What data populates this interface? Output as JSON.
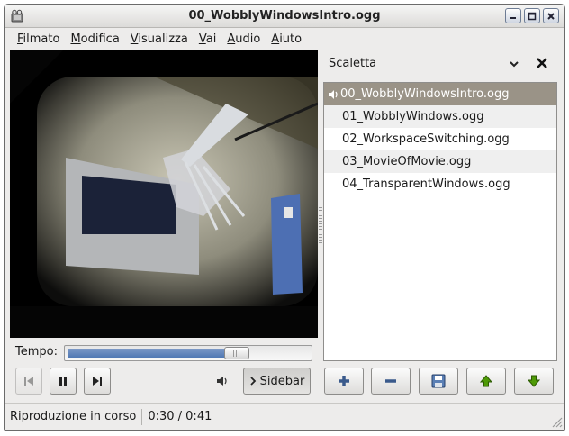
{
  "window": {
    "title": "00_WobblyWindowsIntro.ogg",
    "controls": [
      "minimize-icon",
      "maximize-icon",
      "close-icon"
    ]
  },
  "menubar": {
    "items": [
      {
        "u": "F",
        "rest": "ilmato"
      },
      {
        "u": "M",
        "rest": "odifica"
      },
      {
        "u": "V",
        "rest": "isualizza"
      },
      {
        "u": "V",
        "rest": "ai"
      },
      {
        "u": "A",
        "rest": "udio"
      },
      {
        "u": "A",
        "rest": "iuto"
      }
    ]
  },
  "player": {
    "time_label": "Tempo:",
    "position_fraction": 0.7,
    "buttons": {
      "previous": {
        "icon": "skip-previous-icon",
        "enabled": false
      },
      "pause": {
        "icon": "pause-icon",
        "enabled": true
      },
      "next": {
        "icon": "skip-next-icon",
        "enabled": true
      },
      "volume": {
        "icon": "speaker-icon"
      },
      "sidebar": {
        "icon": "chevron-right-icon",
        "u": "S",
        "rest": "idebar"
      }
    }
  },
  "sidebar": {
    "title": "Scaletta",
    "playlist": [
      {
        "name": "00_WobblyWindowsIntro.ogg",
        "playing": true
      },
      {
        "name": "01_WobblyWindows.ogg",
        "playing": false
      },
      {
        "name": "02_WorkspaceSwitching.ogg",
        "playing": false
      },
      {
        "name": "03_MovieOfMovie.ogg",
        "playing": false
      },
      {
        "name": "04_TransparentWindows.ogg",
        "playing": false
      }
    ],
    "buttons": [
      "add-icon",
      "remove-icon",
      "save-icon",
      "move-up-icon",
      "move-down-icon"
    ]
  },
  "statusbar": {
    "state": "Riproduzione in corso",
    "time": "0:30 / 0:41"
  },
  "colors": {
    "selection": "#9a9387",
    "slider_fill": "#5078b4",
    "add_icon": "#3a5a8c",
    "arrow_icon": "#4e9a06"
  }
}
